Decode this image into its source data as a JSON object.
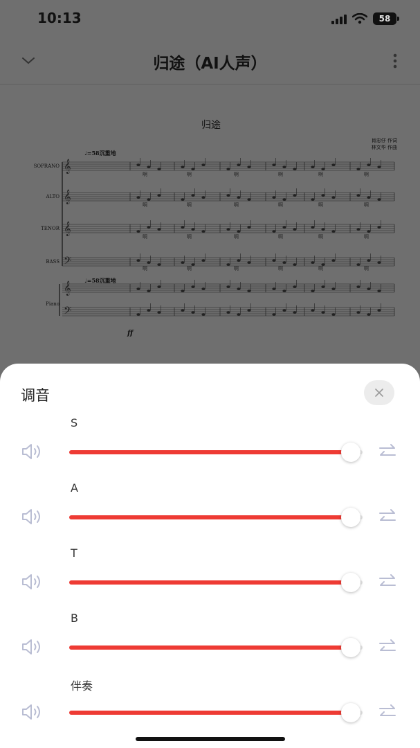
{
  "status": {
    "time": "10:13",
    "battery": "58"
  },
  "header": {
    "title": "归途（AI人声）"
  },
  "score": {
    "title": "归途",
    "credits": [
      "肖忠仔 作词",
      "林文华 作曲"
    ],
    "tempo": "♩=58沉重地",
    "parts": [
      "SOPRANO",
      "ALTO",
      "TENOR",
      "BASS",
      "Piano"
    ],
    "lyric": "啊",
    "dynamic": "ff"
  },
  "sheet": {
    "title": "调音",
    "tracks": [
      {
        "label": "S",
        "level": 1.0
      },
      {
        "label": "A",
        "level": 1.0
      },
      {
        "label": "T",
        "level": 1.0
      },
      {
        "label": "B",
        "level": 1.0
      },
      {
        "label": "伴奏",
        "level": 1.0
      }
    ]
  },
  "colors": {
    "accent": "#ee3b34",
    "icon": "#b9bdd3",
    "overlay": "#6f6f6f"
  },
  "icons": [
    "chevron-down-icon",
    "more-vertical-icon",
    "close-icon",
    "speaker-icon",
    "swap-icon"
  ]
}
